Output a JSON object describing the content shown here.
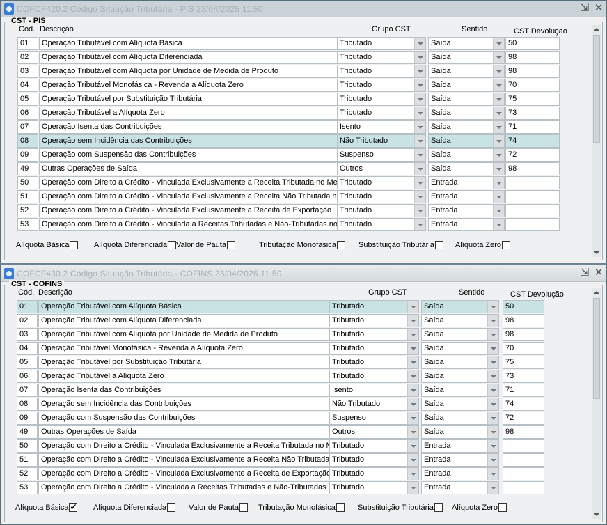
{
  "windows": [
    {
      "title": "COFCF420.2    Código Situação Tributária - PIS     23/04/2025 11:50",
      "legend": "CST - PIS",
      "selected_row": 7,
      "headers": {
        "cod": "Cód.",
        "desc": "Descrição",
        "grupo": "Grupo CST",
        "sentido": "Sentido",
        "devol": "CST Devoluçao"
      },
      "rows": [
        {
          "cod": "01",
          "desc": "Operação Tributável com Alíquota Básica",
          "grupo": "Tributado",
          "sentido": "Saída",
          "devol": "50"
        },
        {
          "cod": "02",
          "desc": "Operação Tributável com Alíquota Diferenciada",
          "grupo": "Tributado",
          "sentido": "Saída",
          "devol": "98"
        },
        {
          "cod": "03",
          "desc": "Operação Tributável com Alíquota por Unidade de Medida de Produto",
          "grupo": "Tributado",
          "sentido": "Saída",
          "devol": "98"
        },
        {
          "cod": "04",
          "desc": "Operação Tributável Monofásica - Revenda a Alíquota Zero",
          "grupo": "Tributado",
          "sentido": "Saída",
          "devol": "70"
        },
        {
          "cod": "05",
          "desc": "Operação Tributável por Substituição Tributária",
          "grupo": "Tributado",
          "sentido": "Saída",
          "devol": "75"
        },
        {
          "cod": "06",
          "desc": "Operação Tributável a Alíquota Zero",
          "grupo": "Tributado",
          "sentido": "Saída",
          "devol": "73"
        },
        {
          "cod": "07",
          "desc": "Operação Isenta das Contribuições",
          "grupo": "Isento",
          "sentido": "Saída",
          "devol": "71"
        },
        {
          "cod": "08",
          "desc": "Operação sem Incidência das Contribuições",
          "grupo": "Não Tributado",
          "sentido": "Saída",
          "devol": "74"
        },
        {
          "cod": "09",
          "desc": "Operação com Suspensão das Contribuições",
          "grupo": "Suspenso",
          "sentido": "Saída",
          "devol": "72"
        },
        {
          "cod": "49",
          "desc": "Outras Operações de Saída",
          "grupo": "Outros",
          "sentido": "Saída",
          "devol": "98"
        },
        {
          "cod": "50",
          "desc": "Operação com Direito a Crédito - Vinculada Exclusivamente a Receita Tributada no Mercado Interno",
          "grupo": "Tributado",
          "sentido": "Entrada",
          "devol": ""
        },
        {
          "cod": "51",
          "desc": "Operação com Direito a Crédito - Vinculada Exclusivamente a Receita Não Tributada no Mercado Interno",
          "grupo": "Tributado",
          "sentido": "Entrada",
          "devol": ""
        },
        {
          "cod": "52",
          "desc": "Operação com Direito a Crédito - Vinculada Exclusivamente a Receita de Exportação",
          "grupo": "Tributado",
          "sentido": "Entrada",
          "devol": ""
        },
        {
          "cod": "53",
          "desc": "Operação com Direito a Crédito - Vinculada a Receitas Tributadas e Não-Tributadas no Mercado Interno",
          "grupo": "Tributado",
          "sentido": "Entrada",
          "devol": ""
        }
      ],
      "checks": [
        {
          "label": "Alíquota Básica",
          "checked": false
        },
        {
          "label": "Alíquota Diferenciada",
          "checked": false
        },
        {
          "label": "Valor de Pauta",
          "checked": false
        },
        {
          "label": "Tributação Monofásica",
          "checked": false
        },
        {
          "label": "Substituição Tributária",
          "checked": false
        },
        {
          "label": "Alíquota Zero",
          "checked": false
        }
      ]
    },
    {
      "title": "COFCF430.2    Código Situação Tributária - COFINS     23/04/2025 11:50",
      "legend": "CST - COFINS",
      "selected_row": 0,
      "headers": {
        "cod": "Cód.",
        "desc": "Descrição",
        "grupo": "Grupo CST",
        "sentido": "Sentido",
        "devol": "CST Devolução"
      },
      "rows": [
        {
          "cod": "01",
          "desc": "Operação Tributável com Alíquota Básica",
          "grupo": "Tributado",
          "sentido": "Saída",
          "devol": "50"
        },
        {
          "cod": "02",
          "desc": "Operação Tributável com Alíquota Diferenciada",
          "grupo": "Tributado",
          "sentido": "Saída",
          "devol": "98"
        },
        {
          "cod": "03",
          "desc": "Operação Tributável com Alíquota por Unidade de Medida de Produto",
          "grupo": "Tributado",
          "sentido": "Saída",
          "devol": "98"
        },
        {
          "cod": "04",
          "desc": "Operação Tributável Monofásica - Revenda a Alíquota Zero",
          "grupo": "Tributado",
          "sentido": "Saída",
          "devol": "70"
        },
        {
          "cod": "05",
          "desc": "Operação Tributável por Substituição Tributária",
          "grupo": "Tributado",
          "sentido": "Saída",
          "devol": "75"
        },
        {
          "cod": "06",
          "desc": "Operação Tributável a Alíquota Zero",
          "grupo": "Tributado",
          "sentido": "Saída",
          "devol": "73"
        },
        {
          "cod": "07",
          "desc": "Operação Isenta das Contribuições",
          "grupo": "Isento",
          "sentido": "Saída",
          "devol": "71"
        },
        {
          "cod": "08",
          "desc": "Operação sem Incidência das Contribuições",
          "grupo": "Não Tributado",
          "sentido": "Saída",
          "devol": "74"
        },
        {
          "cod": "09",
          "desc": "Operação com Suspensão das Contribuições",
          "grupo": "Suspenso",
          "sentido": "Saída",
          "devol": "72"
        },
        {
          "cod": "49",
          "desc": "Outras Operações de Saída",
          "grupo": "Outros",
          "sentido": "Saída",
          "devol": "98"
        },
        {
          "cod": "50",
          "desc": "Operação com Direito a Crédito - Vinculada Exclusivamente a Receita Tributada no Mercado Interno",
          "grupo": "Tributado",
          "sentido": "Entrada",
          "devol": ""
        },
        {
          "cod": "51",
          "desc": "Operação com Direito a Crédito - Vinculada Exclusivamente a Receita Não Tributada no Mercado Interno",
          "grupo": "Tributado",
          "sentido": "Entrada",
          "devol": ""
        },
        {
          "cod": "52",
          "desc": "Operação com Direito a Crédito - Vinculada Exclusivamente a Receita de Exportação",
          "grupo": "Tributado",
          "sentido": "Entrada",
          "devol": ""
        },
        {
          "cod": "53",
          "desc": "Operação com Direito a Crédito - Vinculada a Receitas Tributadas e Não-Tributadas no Mercado Interno",
          "grupo": "Tributado",
          "sentido": "Entrada",
          "devol": ""
        }
      ],
      "checks": [
        {
          "label": "Alíquota Básica",
          "checked": true
        },
        {
          "label": "Alíquota Diferenciada",
          "checked": false
        },
        {
          "label": "Valor de Pauta",
          "checked": false
        },
        {
          "label": "Tributação Monofásica",
          "checked": false
        },
        {
          "label": "Substituição Tributária",
          "checked": false
        },
        {
          "label": "Alíquota Zero",
          "checked": false
        }
      ]
    }
  ],
  "icons": {
    "app": "app-icon",
    "minimize": "minimize-icon",
    "close": "close-icon"
  }
}
